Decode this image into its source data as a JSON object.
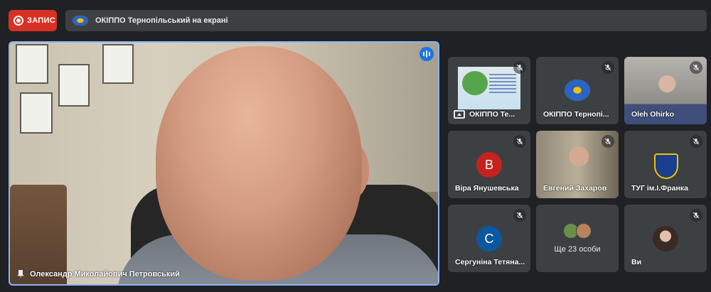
{
  "top_bar": {
    "record_label": "ЗАПИС",
    "presenting_banner": "ОКІППО Тернопільський на екрані"
  },
  "main_video": {
    "speaker_name": "Олександр Миколайович Петровський"
  },
  "participants": [
    {
      "name": "ОКІППО Те...",
      "kind": "screen-share",
      "muted": true
    },
    {
      "name": "ОКІППО Тернопі...",
      "kind": "logo",
      "muted": true
    },
    {
      "name": "Oleh Ohirko",
      "kind": "video",
      "muted": true
    },
    {
      "name": "Віра Янушевська",
      "kind": "avatar",
      "initial": "В",
      "avatar_color": "#c5221f",
      "muted": true
    },
    {
      "name": "Евгений Захаров",
      "kind": "video",
      "muted": true
    },
    {
      "name": "ТУГ ім.І.Франка",
      "kind": "emblem",
      "muted": true
    },
    {
      "name": "Сергуніна Тетяна...",
      "kind": "avatar",
      "initial": "С",
      "avatar_color": "#0b57a0",
      "muted": true
    },
    {
      "name": "Ще 23 особи",
      "kind": "overflow"
    },
    {
      "name": "Ви",
      "kind": "self",
      "muted": true
    }
  ],
  "colors": {
    "background": "#202124",
    "tile": "#3c4043",
    "record": "#d93025",
    "active_speaker_border": "#8ab4f8"
  },
  "icons": {
    "record": "record-icon",
    "mute": "mic-off-icon",
    "pin": "pin-icon",
    "speaking": "speaking-indicator-icon",
    "presenting": "present-screen-icon"
  }
}
